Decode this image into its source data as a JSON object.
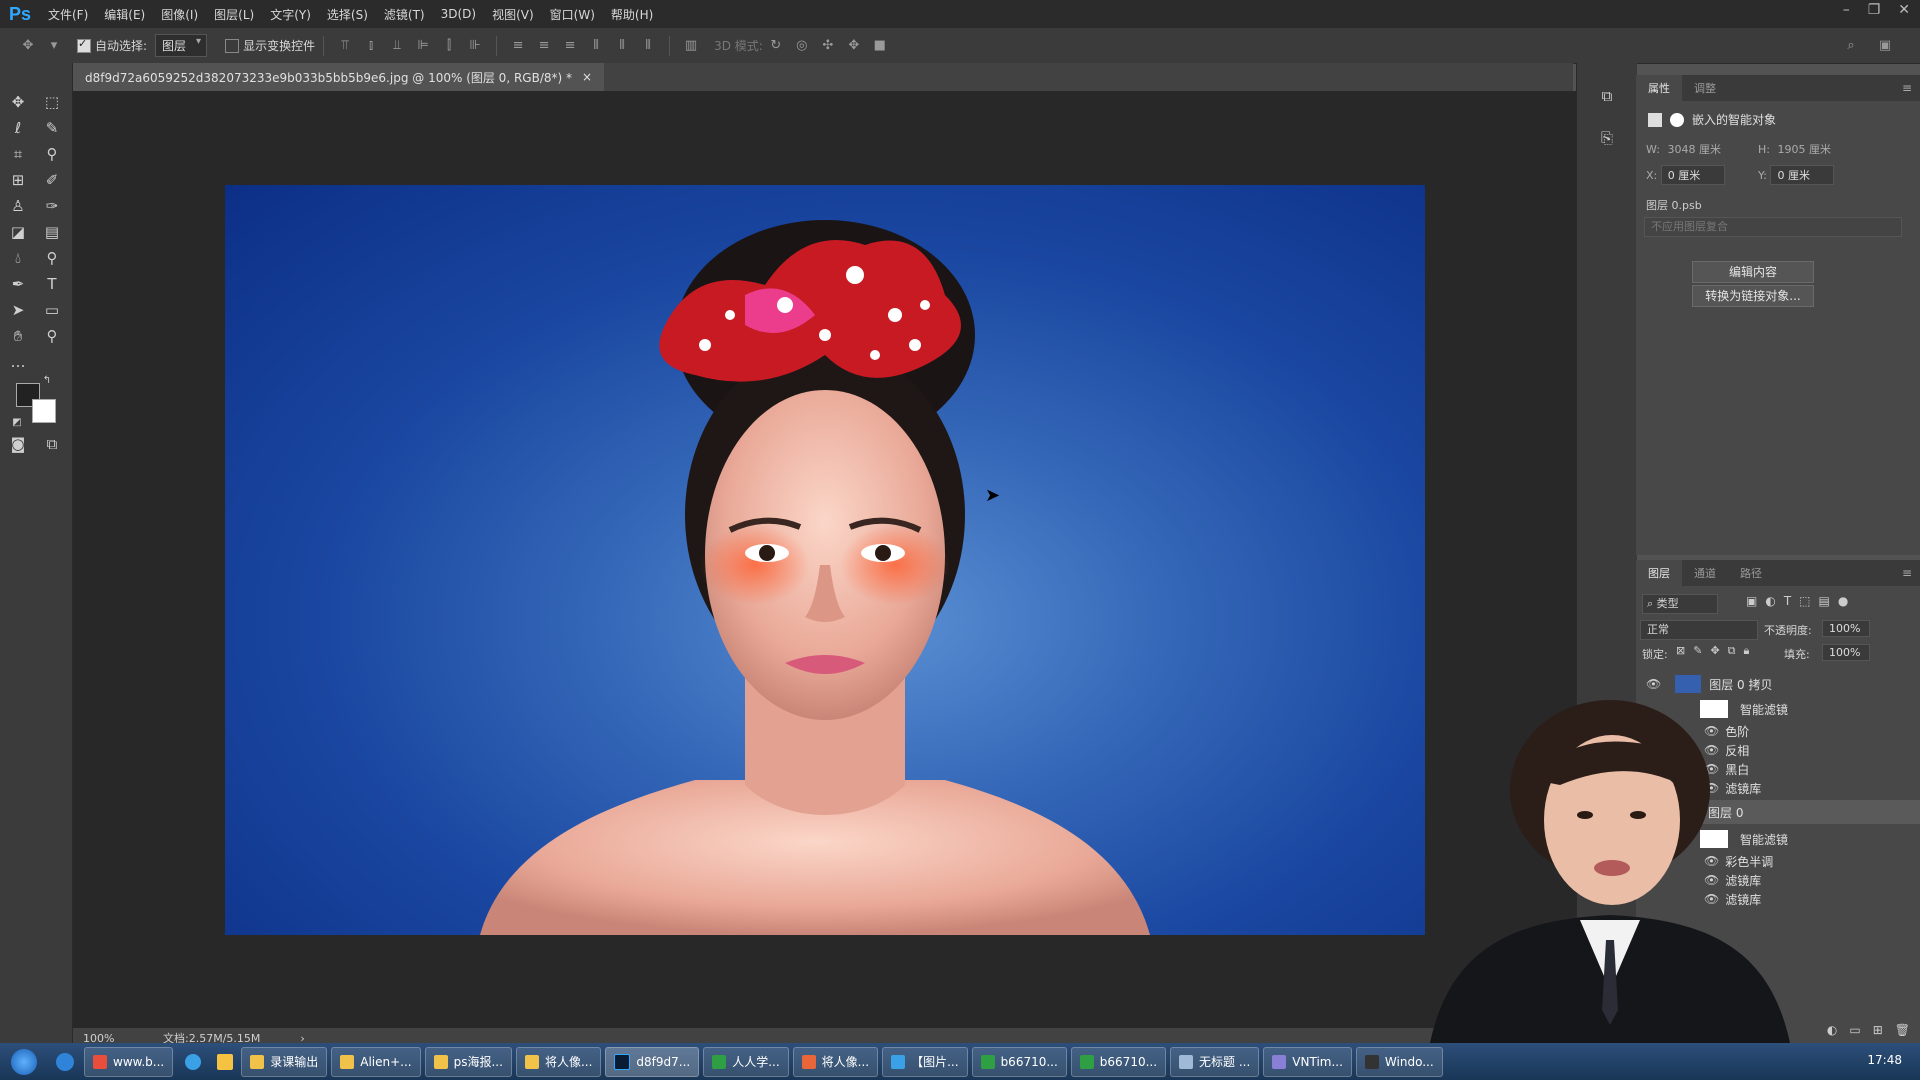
{
  "app": {
    "logo": "Ps"
  },
  "menu": [
    "文件(F)",
    "编辑(E)",
    "图像(I)",
    "图层(L)",
    "文字(Y)",
    "选择(S)",
    "滤镜(T)",
    "3D(D)",
    "视图(V)",
    "窗口(W)",
    "帮助(H)"
  ],
  "options": {
    "auto_select_label": "自动选择:",
    "auto_select_value": "图层",
    "show_transform_label": "显示变换控件",
    "mode_3d_label": "3D 模式:"
  },
  "document": {
    "tab_title": "d8f9d72a6059252d382073233e9b033b5bb5b9e6.jpg @ 100% (图层 0, RGB/8*) *",
    "close": "×"
  },
  "status": {
    "zoom": "100%",
    "doc_size": "文档:2.57M/5.15M",
    "arrow": "›"
  },
  "properties": {
    "tabs": [
      "属性",
      "调整"
    ],
    "type_label": "嵌入的智能对象",
    "w_label": "W:",
    "w_value": "3048 厘米",
    "h_label": "H:",
    "h_value": "1905 厘米",
    "x_label": "X:",
    "x_value": "0 厘米",
    "y_label": "Y:",
    "y_value": "0 厘米",
    "file_name": "图层 0.psb",
    "comp_placeholder": "不应用图层复合",
    "edit_contents": "编辑内容",
    "convert_linked": "转换为链接对象..."
  },
  "layers_panel": {
    "tabs": [
      "图层",
      "通道",
      "路径"
    ],
    "filter_kind": "类型",
    "blend_mode": "正常",
    "opacity_label": "不透明度:",
    "opacity_value": "100%",
    "lock_label": "锁定:",
    "fill_label": "填充:",
    "fill_value": "100%",
    "rows": [
      {
        "name": "图层 0 拷贝"
      },
      {
        "name": "智能滤镜"
      },
      {
        "name": "色阶"
      },
      {
        "name": "反相"
      },
      {
        "name": "黑白"
      },
      {
        "name": "滤镜库"
      },
      {
        "name": "图层 0"
      },
      {
        "name": "智能滤镜"
      },
      {
        "name": "彩色半调"
      },
      {
        "name": "滤镜库"
      },
      {
        "name": "滤镜库"
      }
    ]
  },
  "taskbar": {
    "items": [
      "www.b...",
      "录课输出",
      "Alien+...",
      "ps海报...",
      "将人像...",
      "d8f9d7...",
      "人人学...",
      "将人像...",
      "【图片...",
      "b66710...",
      "b66710...",
      "无标题 ...",
      "VNTim...",
      "Windo..."
    ],
    "clock": "17:48"
  },
  "colors": {
    "accent_ps": "#31a8ff",
    "image_bg": "#1a47a1"
  }
}
